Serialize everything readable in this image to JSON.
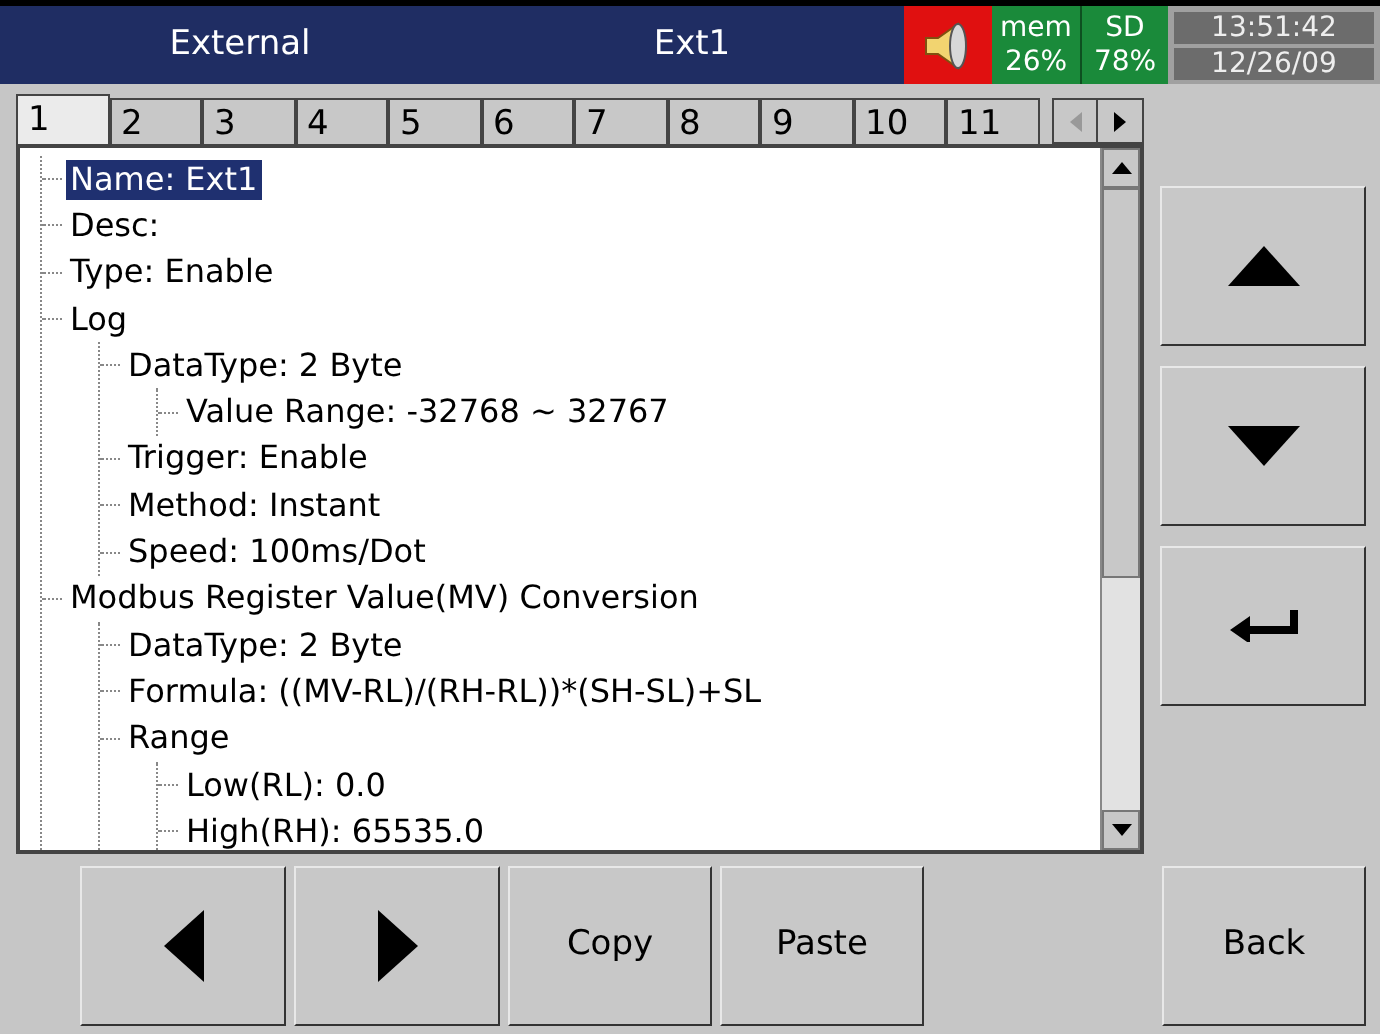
{
  "header": {
    "section": "External",
    "title": "Ext1",
    "mem_label": "mem",
    "mem_value": "26%",
    "sd_label": "SD",
    "sd_value": "78%",
    "time": "13:51:42",
    "date": "12/26/09"
  },
  "tabs": [
    {
      "label": "1",
      "selected": true
    },
    {
      "label": "2",
      "selected": false
    },
    {
      "label": "3",
      "selected": false
    },
    {
      "label": "4",
      "selected": false
    },
    {
      "label": "5",
      "selected": false
    },
    {
      "label": "6",
      "selected": false
    },
    {
      "label": "7",
      "selected": false
    },
    {
      "label": "8",
      "selected": false
    },
    {
      "label": "9",
      "selected": false
    },
    {
      "label": "10",
      "selected": false
    },
    {
      "label": "11",
      "selected": false
    }
  ],
  "tree": [
    {
      "label": "Name: Ext1",
      "selected": true
    },
    {
      "label": "Desc:",
      "selected": false
    },
    {
      "label": "Type: Enable",
      "selected": false
    },
    {
      "label": "Log",
      "selected": false,
      "children": [
        {
          "label": "DataType: 2 Byte",
          "selected": false,
          "children": [
            {
              "label": "Value Range: -32768 ~ 32767",
              "selected": false
            }
          ]
        },
        {
          "label": "Trigger: Enable",
          "selected": false
        },
        {
          "label": "Method: Instant",
          "selected": false
        },
        {
          "label": "Speed: 100ms/Dot",
          "selected": false
        }
      ]
    },
    {
      "label": "Modbus Register Value(MV) Conversion",
      "selected": false,
      "children": [
        {
          "label": "DataType: 2 Byte",
          "selected": false
        },
        {
          "label": "Formula: ((MV-RL)/(RH-RL))*(SH-SL)+SL",
          "selected": false
        },
        {
          "label": "Range",
          "selected": false,
          "children": [
            {
              "label": "Low(RL): 0.0",
              "selected": false
            },
            {
              "label": "High(RH): 65535.0",
              "selected": false
            }
          ]
        }
      ]
    }
  ],
  "buttons": [
    {
      "kind": "left"
    },
    {
      "kind": "right"
    },
    {
      "kind": "text",
      "label": "Copy"
    },
    {
      "kind": "text",
      "label": "Paste"
    },
    {
      "kind": "gap"
    },
    {
      "kind": "text",
      "label": "Back"
    }
  ]
}
